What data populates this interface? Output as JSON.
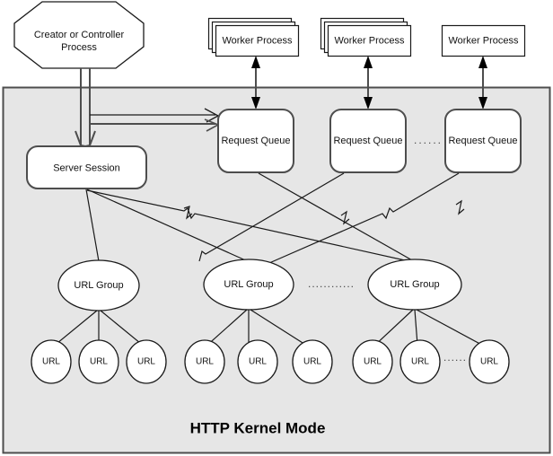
{
  "diagram": {
    "title": "HTTP Kernel Mode",
    "kernel_panel": {
      "label": "HTTP Kernel Mode",
      "fill_color": "#e6e6e6",
      "border_color": "#4d4d4d"
    },
    "creator": {
      "label_line1": "Creator or Controller",
      "label_line2": "Process",
      "shape": "octagon"
    },
    "server_session": {
      "label": "Server Session",
      "shape": "rounded-rect"
    },
    "workers": [
      {
        "label": "Worker Process",
        "stacked": true
      },
      {
        "label": "Worker Process",
        "stacked": true
      },
      {
        "label": "Worker Process",
        "stacked": false
      }
    ],
    "request_queues": [
      {
        "label": "Request Queue"
      },
      {
        "label": "Request Queue"
      },
      {
        "label": "Request Queue"
      }
    ],
    "request_queue_ellipsis": "......",
    "url_groups": [
      {
        "label": "URL Group"
      },
      {
        "label": "URL Group"
      },
      {
        "label": "URL Group"
      }
    ],
    "url_group_ellipsis": "............",
    "urls": [
      {
        "label": "URL"
      },
      {
        "label": "URL"
      },
      {
        "label": "URL"
      },
      {
        "label": "URL"
      },
      {
        "label": "URL"
      },
      {
        "label": "URL"
      },
      {
        "label": "URL"
      },
      {
        "label": "URL"
      },
      {
        "label": "URL"
      }
    ],
    "url_ellipsis": "......",
    "colors": {
      "node_fill": "#ffffff",
      "node_stroke": "#1a1a1a",
      "thick_stroke": "#4d4d4d",
      "panel_fill": "#e6e6e6",
      "text": "#111111"
    }
  }
}
